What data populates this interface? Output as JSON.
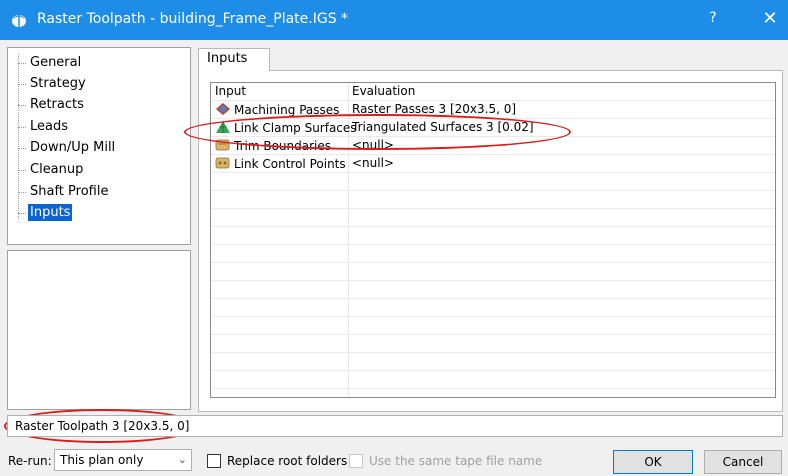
{
  "window": {
    "title": "Raster Toolpath - building_Frame_Plate.IGS *",
    "help_label": "?",
    "close_label": "✕"
  },
  "tree": {
    "items": [
      {
        "label": "General"
      },
      {
        "label": "Strategy"
      },
      {
        "label": "Retracts"
      },
      {
        "label": "Leads"
      },
      {
        "label": "Down/Up Mill"
      },
      {
        "label": "Cleanup"
      },
      {
        "label": "Shaft Profile"
      },
      {
        "label": "Inputs",
        "selected": true
      }
    ]
  },
  "tab": {
    "label": "Inputs"
  },
  "table": {
    "headers": {
      "input": "Input",
      "evaluation": "Evaluation"
    },
    "rows": [
      {
        "icon": "machining-passes-icon",
        "input": "Machining Passes",
        "evaluation": "Raster Passes 3 [20x3.5, 0]"
      },
      {
        "icon": "triangulated-surface-icon",
        "input": "Link Clamp Surfaces",
        "evaluation": "Triangulated Surfaces 3 [0.02]"
      },
      {
        "icon": "trim-boundaries-icon",
        "input": "Trim Boundaries",
        "evaluation": "<null>"
      },
      {
        "icon": "link-control-points-icon",
        "input": "Link Control Points",
        "evaluation": "<null>"
      }
    ]
  },
  "status": {
    "text": "Raster Toolpath 3 [20x3.5, 0]"
  },
  "bottom": {
    "rerun_label": "Re-run:",
    "rerun_value": "This plan only",
    "replace_root_label": "Replace root folders",
    "same_tape_label": "Use the same tape file name",
    "ok_label": "OK",
    "cancel_label": "Cancel"
  },
  "colors": {
    "titlebar": "#1e8de8",
    "selection": "#0a64d2",
    "annotation": "#d81d1d"
  }
}
